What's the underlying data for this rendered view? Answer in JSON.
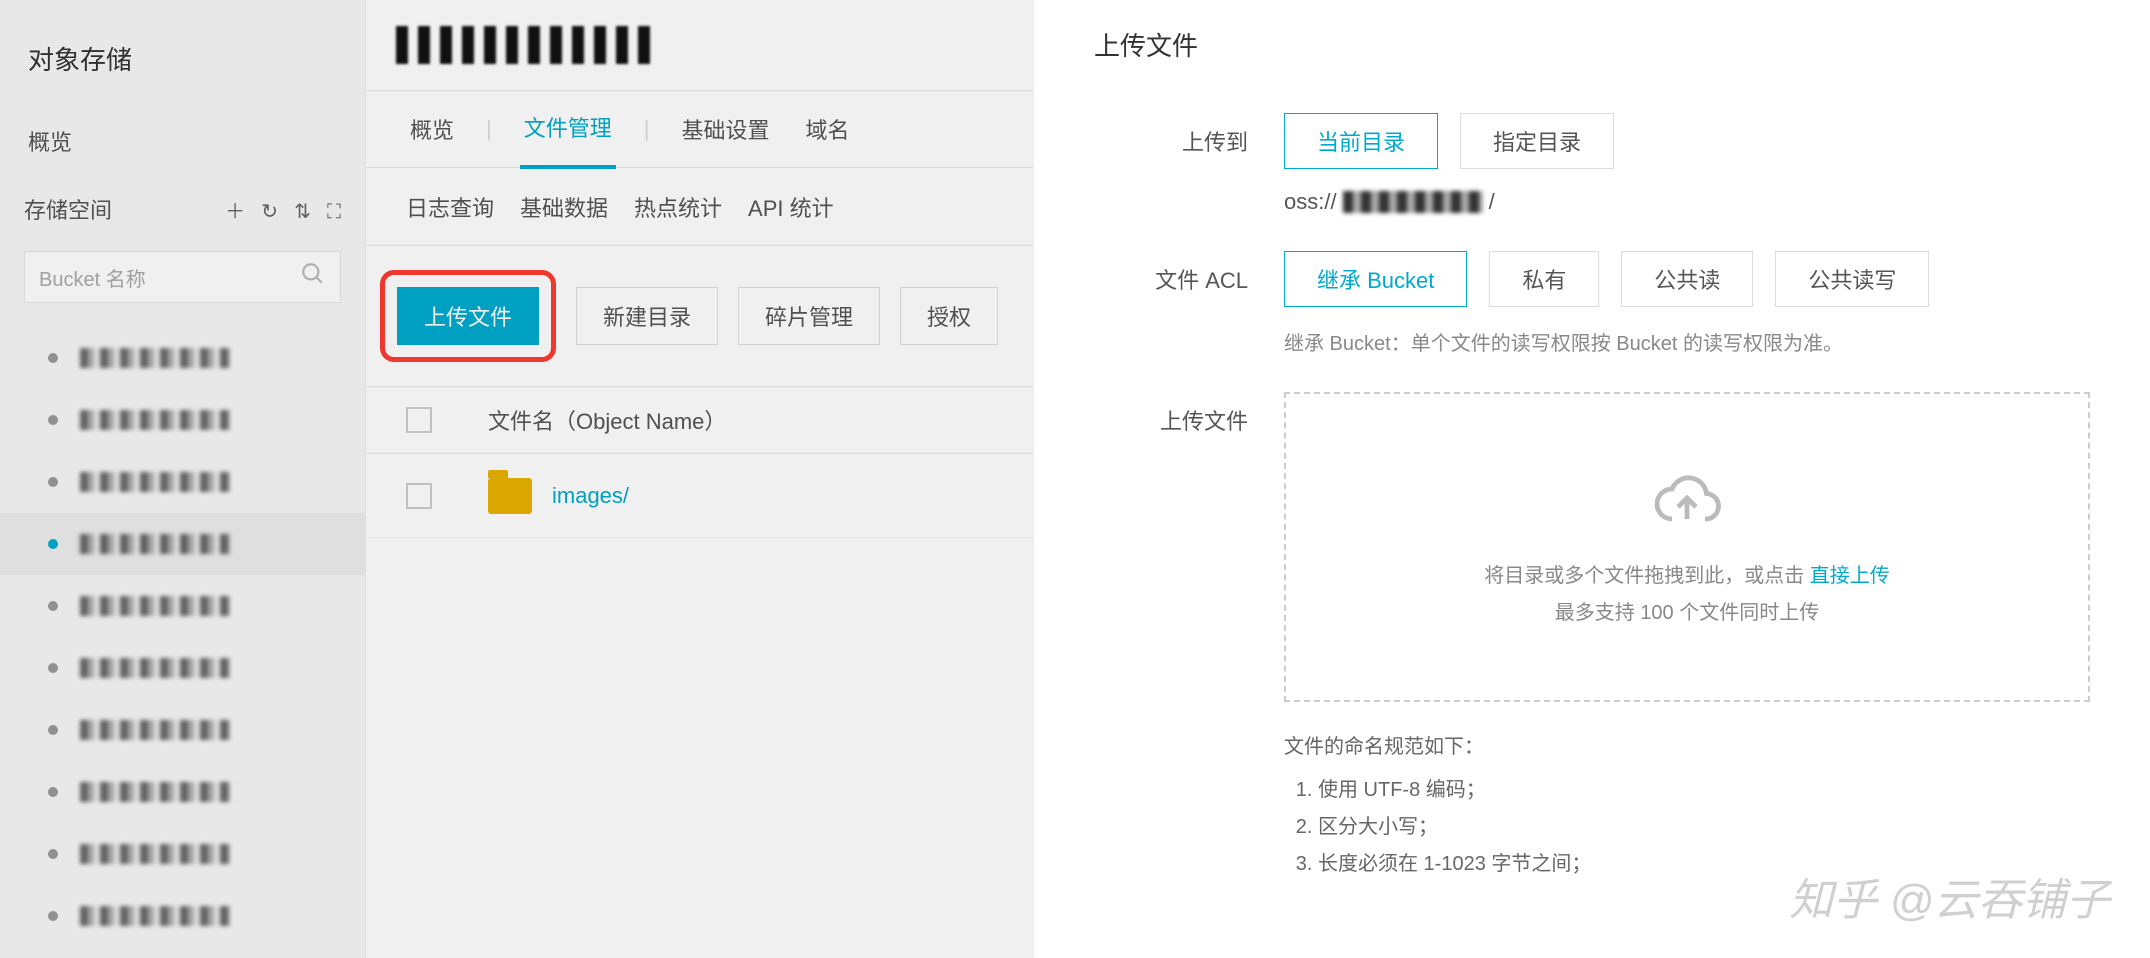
{
  "sidebar": {
    "title": "对象存储",
    "overview": "概览",
    "storage_label": "存储空间",
    "search_placeholder": "Bucket 名称",
    "bucket_count": 10,
    "active_index": 3
  },
  "content": {
    "tabs": {
      "overview": "概览",
      "file_mgmt": "文件管理",
      "basic_settings": "基础设置",
      "domain": "域名"
    },
    "active_tab": "file_mgmt",
    "subtabs": {
      "log_query": "日志查询",
      "basic_data": "基础数据",
      "hotspot": "热点统计",
      "api_stats": "API 统计"
    },
    "actions": {
      "upload": "上传文件",
      "new_folder": "新建目录",
      "fragments": "碎片管理",
      "authorize": "授权"
    },
    "table_header": "文件名（Object Name）",
    "rows": [
      {
        "name": "images/"
      }
    ]
  },
  "panel": {
    "title": "上传文件",
    "upload_to_label": "上传到",
    "upload_to": {
      "current": "当前目录",
      "specified": "指定目录",
      "selected": "current"
    },
    "path_prefix": "oss://",
    "path_suffix": "/",
    "acl_label": "文件 ACL",
    "acl": {
      "inherit": "继承 Bucket",
      "private": "私有",
      "public_read": "公共读",
      "public_read_write": "公共读写",
      "selected": "inherit"
    },
    "acl_desc": "继承 Bucket：单个文件的读写权限按 Bucket 的读写权限为准。",
    "upload_label": "上传文件",
    "dropzone": {
      "line1_prefix": "将目录或多个文件拖拽到此，或点击",
      "line1_link": "直接上传",
      "line2": "最多支持 100 个文件同时上传"
    },
    "naming": {
      "heading": "文件的命名规范如下：",
      "rules": [
        "使用 UTF-8 编码；",
        "区分大小写；",
        "长度必须在 1-1023 字节之间；"
      ]
    }
  },
  "watermark": "知乎 @云吞铺子"
}
